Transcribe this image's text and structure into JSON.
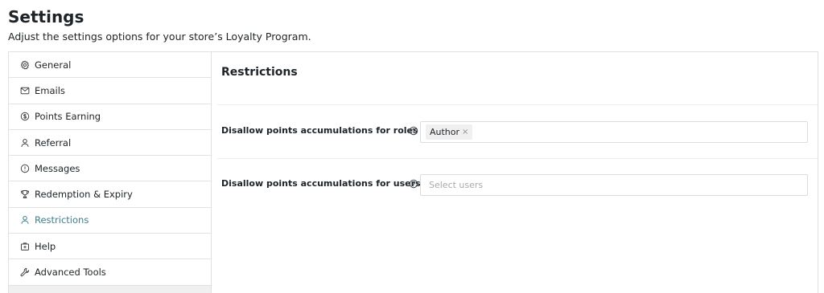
{
  "header": {
    "title": "Settings",
    "subtitle": "Adjust the settings options for your store’s Loyalty Program."
  },
  "sidebar": {
    "items": [
      {
        "label": "General",
        "icon": "gear-icon",
        "active": false
      },
      {
        "label": "Emails",
        "icon": "envelope-icon",
        "active": false
      },
      {
        "label": "Points Earning",
        "icon": "dollar-circle-icon",
        "active": false
      },
      {
        "label": "Referral",
        "icon": "user-icon",
        "active": false
      },
      {
        "label": "Messages",
        "icon": "info-circle-icon",
        "active": false
      },
      {
        "label": "Redemption & Expiry",
        "icon": "trophy-icon",
        "active": false
      },
      {
        "label": "Restrictions",
        "icon": "user-icon",
        "active": true
      },
      {
        "label": "Help",
        "icon": "lifebuoy-icon",
        "active": false
      },
      {
        "label": "Advanced Tools",
        "icon": "wrench-icon",
        "active": false
      }
    ]
  },
  "main": {
    "section_title": "Restrictions",
    "fields": [
      {
        "label": "Disallow points accumulations for roles",
        "tags": [
          "Author"
        ],
        "tag_remove": "×",
        "placeholder": ""
      },
      {
        "label": "Disallow points accumulations for users",
        "tags": [],
        "placeholder": "Select users"
      }
    ]
  },
  "colors": {
    "active_nav": "#3f7d8c",
    "border": "#e0e0e0",
    "text": "#1d2327"
  }
}
